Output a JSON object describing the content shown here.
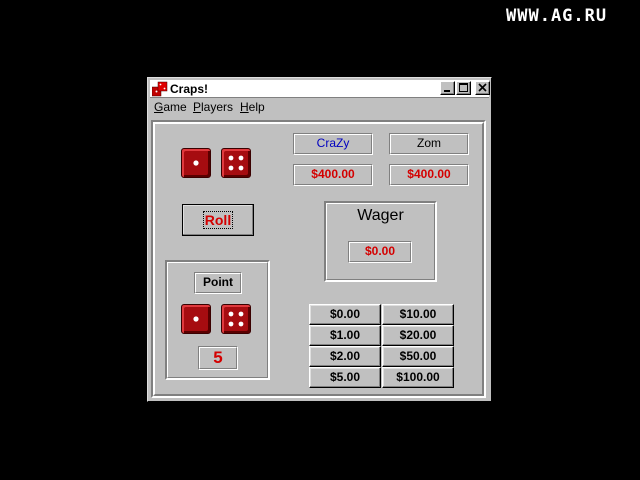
{
  "watermark": "WWW.AG.RU",
  "window": {
    "title": "Craps!",
    "controls": [
      "minimize",
      "maximize",
      "close"
    ]
  },
  "menu": {
    "game": {
      "underline": "G",
      "rest": "ame"
    },
    "players": {
      "underline": "P",
      "rest": "layers"
    },
    "help": {
      "underline": "H",
      "rest": "elp"
    }
  },
  "dice": {
    "roll": [
      1,
      4
    ],
    "point": [
      1,
      4
    ],
    "color": "#a60c10"
  },
  "roll_button": "Roll",
  "players": [
    {
      "name": "CraZy",
      "name_color": "#0000c0",
      "bankroll": "$400.00"
    },
    {
      "name": "Zom",
      "name_color": "#000000",
      "bankroll": "$400.00"
    }
  ],
  "wager": {
    "label": "Wager",
    "amount": "$0.00"
  },
  "point": {
    "label": "Point",
    "value": "5"
  },
  "bet_buttons": [
    [
      "$0.00",
      "$10.00"
    ],
    [
      "$1.00",
      "$20.00"
    ],
    [
      "$2.00",
      "$50.00"
    ],
    [
      "$5.00",
      "$100.00"
    ]
  ],
  "colors": {
    "money": "#d40000",
    "titlebar": "#ffffff",
    "window": "#c0c0c0"
  }
}
